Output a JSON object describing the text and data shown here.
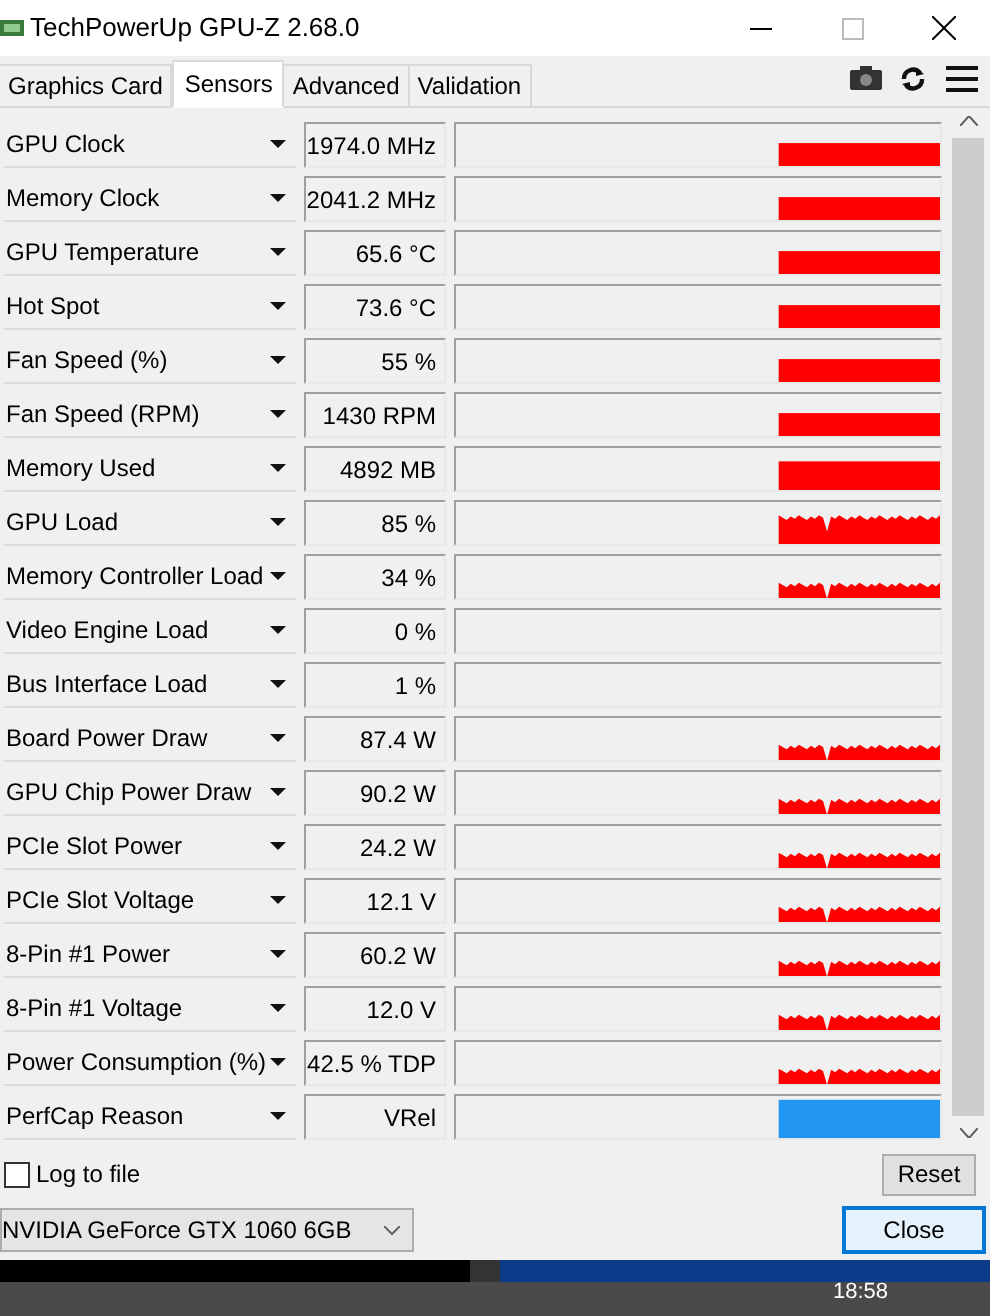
{
  "window": {
    "title": "TechPowerUp GPU-Z 2.68.0"
  },
  "tabs": [
    {
      "label": "Graphics Card",
      "selected": false
    },
    {
      "label": "Sensors",
      "selected": true
    },
    {
      "label": "Advanced",
      "selected": false
    },
    {
      "label": "Validation",
      "selected": false
    }
  ],
  "sensors": [
    {
      "name": "GPU Clock",
      "value": "1974.0 MHz",
      "kind": "steady"
    },
    {
      "name": "Memory Clock",
      "value": "2041.2 MHz",
      "kind": "steady"
    },
    {
      "name": "GPU Temperature",
      "value": "65.6 °C",
      "kind": "steady"
    },
    {
      "name": "Hot Spot",
      "value": "73.6 °C",
      "kind": "steady"
    },
    {
      "name": "Fan Speed (%)",
      "value": "55 %",
      "kind": "steady"
    },
    {
      "name": "Fan Speed (RPM)",
      "value": "1430 RPM",
      "kind": "steady"
    },
    {
      "name": "Memory Used",
      "value": "4892 MB",
      "kind": "tall"
    },
    {
      "name": "GPU Load",
      "value": "85 %",
      "kind": "busy"
    },
    {
      "name": "Memory Controller Load",
      "value": "34 %",
      "kind": "noisy"
    },
    {
      "name": "Video Engine Load",
      "value": "0 %",
      "kind": "idle"
    },
    {
      "name": "Bus Interface Load",
      "value": "1 %",
      "kind": "idle"
    },
    {
      "name": "Board Power Draw",
      "value": "87.4 W",
      "kind": "noisy"
    },
    {
      "name": "GPU Chip Power Draw",
      "value": "90.2 W",
      "kind": "noisy"
    },
    {
      "name": "PCIe Slot Power",
      "value": "24.2 W",
      "kind": "noisy"
    },
    {
      "name": "PCIe Slot Voltage",
      "value": "12.1 V",
      "kind": "noisy"
    },
    {
      "name": "8-Pin #1 Power",
      "value": "60.2 W",
      "kind": "noisy"
    },
    {
      "name": "8-Pin #1 Voltage",
      "value": "12.0 V",
      "kind": "noisy"
    },
    {
      "name": "Power Consumption (%)",
      "value": "42.5 % TDP",
      "kind": "noisy"
    },
    {
      "name": "PerfCap Reason",
      "value": "VRel",
      "kind": "status"
    }
  ],
  "log_to_file": {
    "label": "Log to file",
    "checked": false
  },
  "reset_button": "Reset",
  "device_select": {
    "value": "NVIDIA GeForce GTX 1060 6GB"
  },
  "close_button": "Close",
  "taskbar": {
    "time": "18:58"
  }
}
